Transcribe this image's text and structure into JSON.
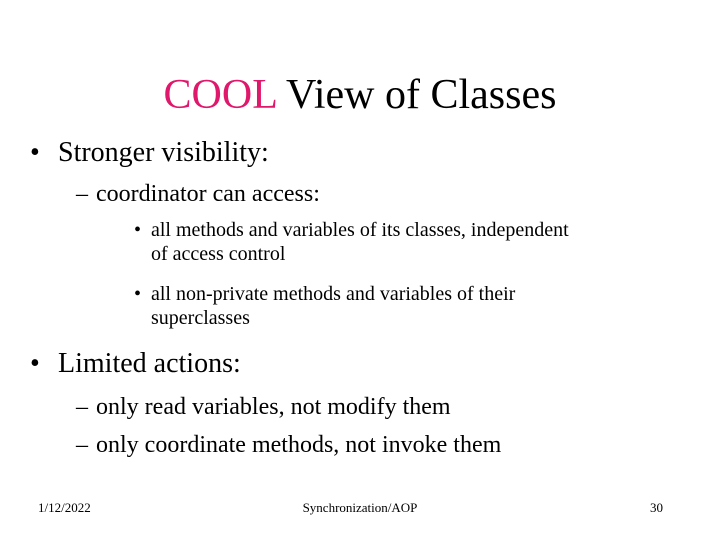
{
  "slide": {
    "title": {
      "accent": "COOL",
      "rest": " View of Classes",
      "accent_color": "#e0186c"
    },
    "sections": [
      {
        "bullet": "•",
        "text": "Stronger visibility:",
        "sub": [
          {
            "dash": "–",
            "text": "coordinator can access:",
            "items": [
              {
                "bullet": "•",
                "line1": "all methods and variables of its classes, independent",
                "line2": "of access control"
              },
              {
                "bullet": "•",
                "line1": "all non-private methods and variables of their",
                "line2": "superclasses"
              }
            ]
          }
        ]
      },
      {
        "bullet": "•",
        "text": "Limited actions:",
        "sub": [
          {
            "dash": "–",
            "text": "only read variables, not modify them"
          },
          {
            "dash": "–",
            "text": "only coordinate methods, not invoke them"
          }
        ]
      }
    ],
    "footer": {
      "date": "1/12/2022",
      "center": "Synchronization/AOP",
      "page": "30"
    }
  }
}
